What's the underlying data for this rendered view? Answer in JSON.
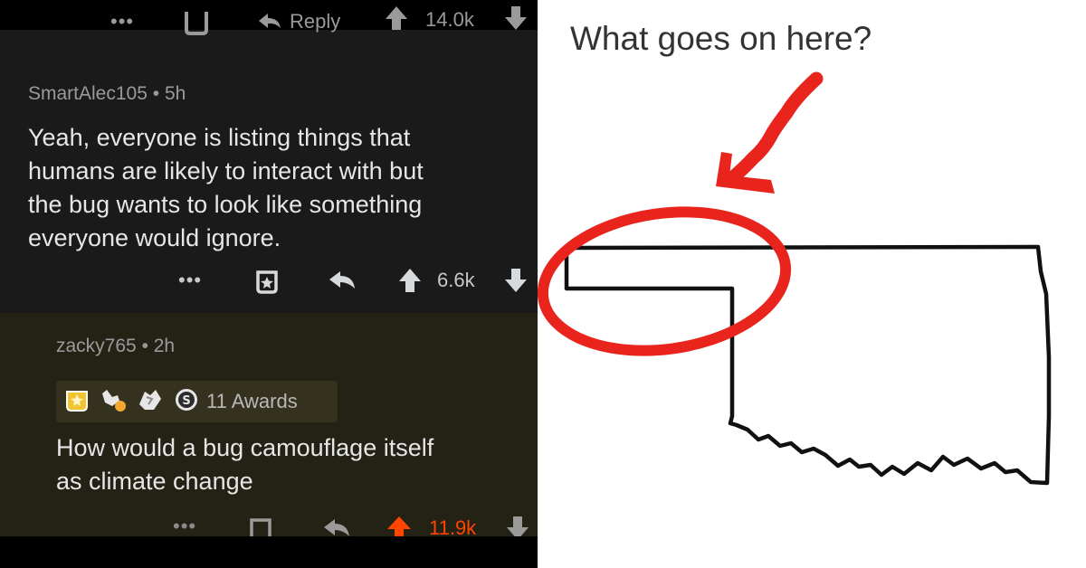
{
  "colors": {
    "upvote_orange": "#ff4500",
    "red_marker": "#e8241c"
  },
  "top_comment_cutoff": {
    "reply_label": "Reply",
    "score": "14.0k"
  },
  "comment1": {
    "author": "SmartAlec105",
    "time": "5h",
    "text": "Yeah, everyone is listing things that\nhumans are likely to interact with but\nthe bug wants to look like something\neveryone would ignore.",
    "score": "6.6k"
  },
  "comment2": {
    "author": "zacky765",
    "time": "2h",
    "awards_label": "11 Awards",
    "text": "How would a bug camouflage itself\nas climate change",
    "score": "11.9k"
  },
  "meme": {
    "caption": "What goes on here?"
  }
}
